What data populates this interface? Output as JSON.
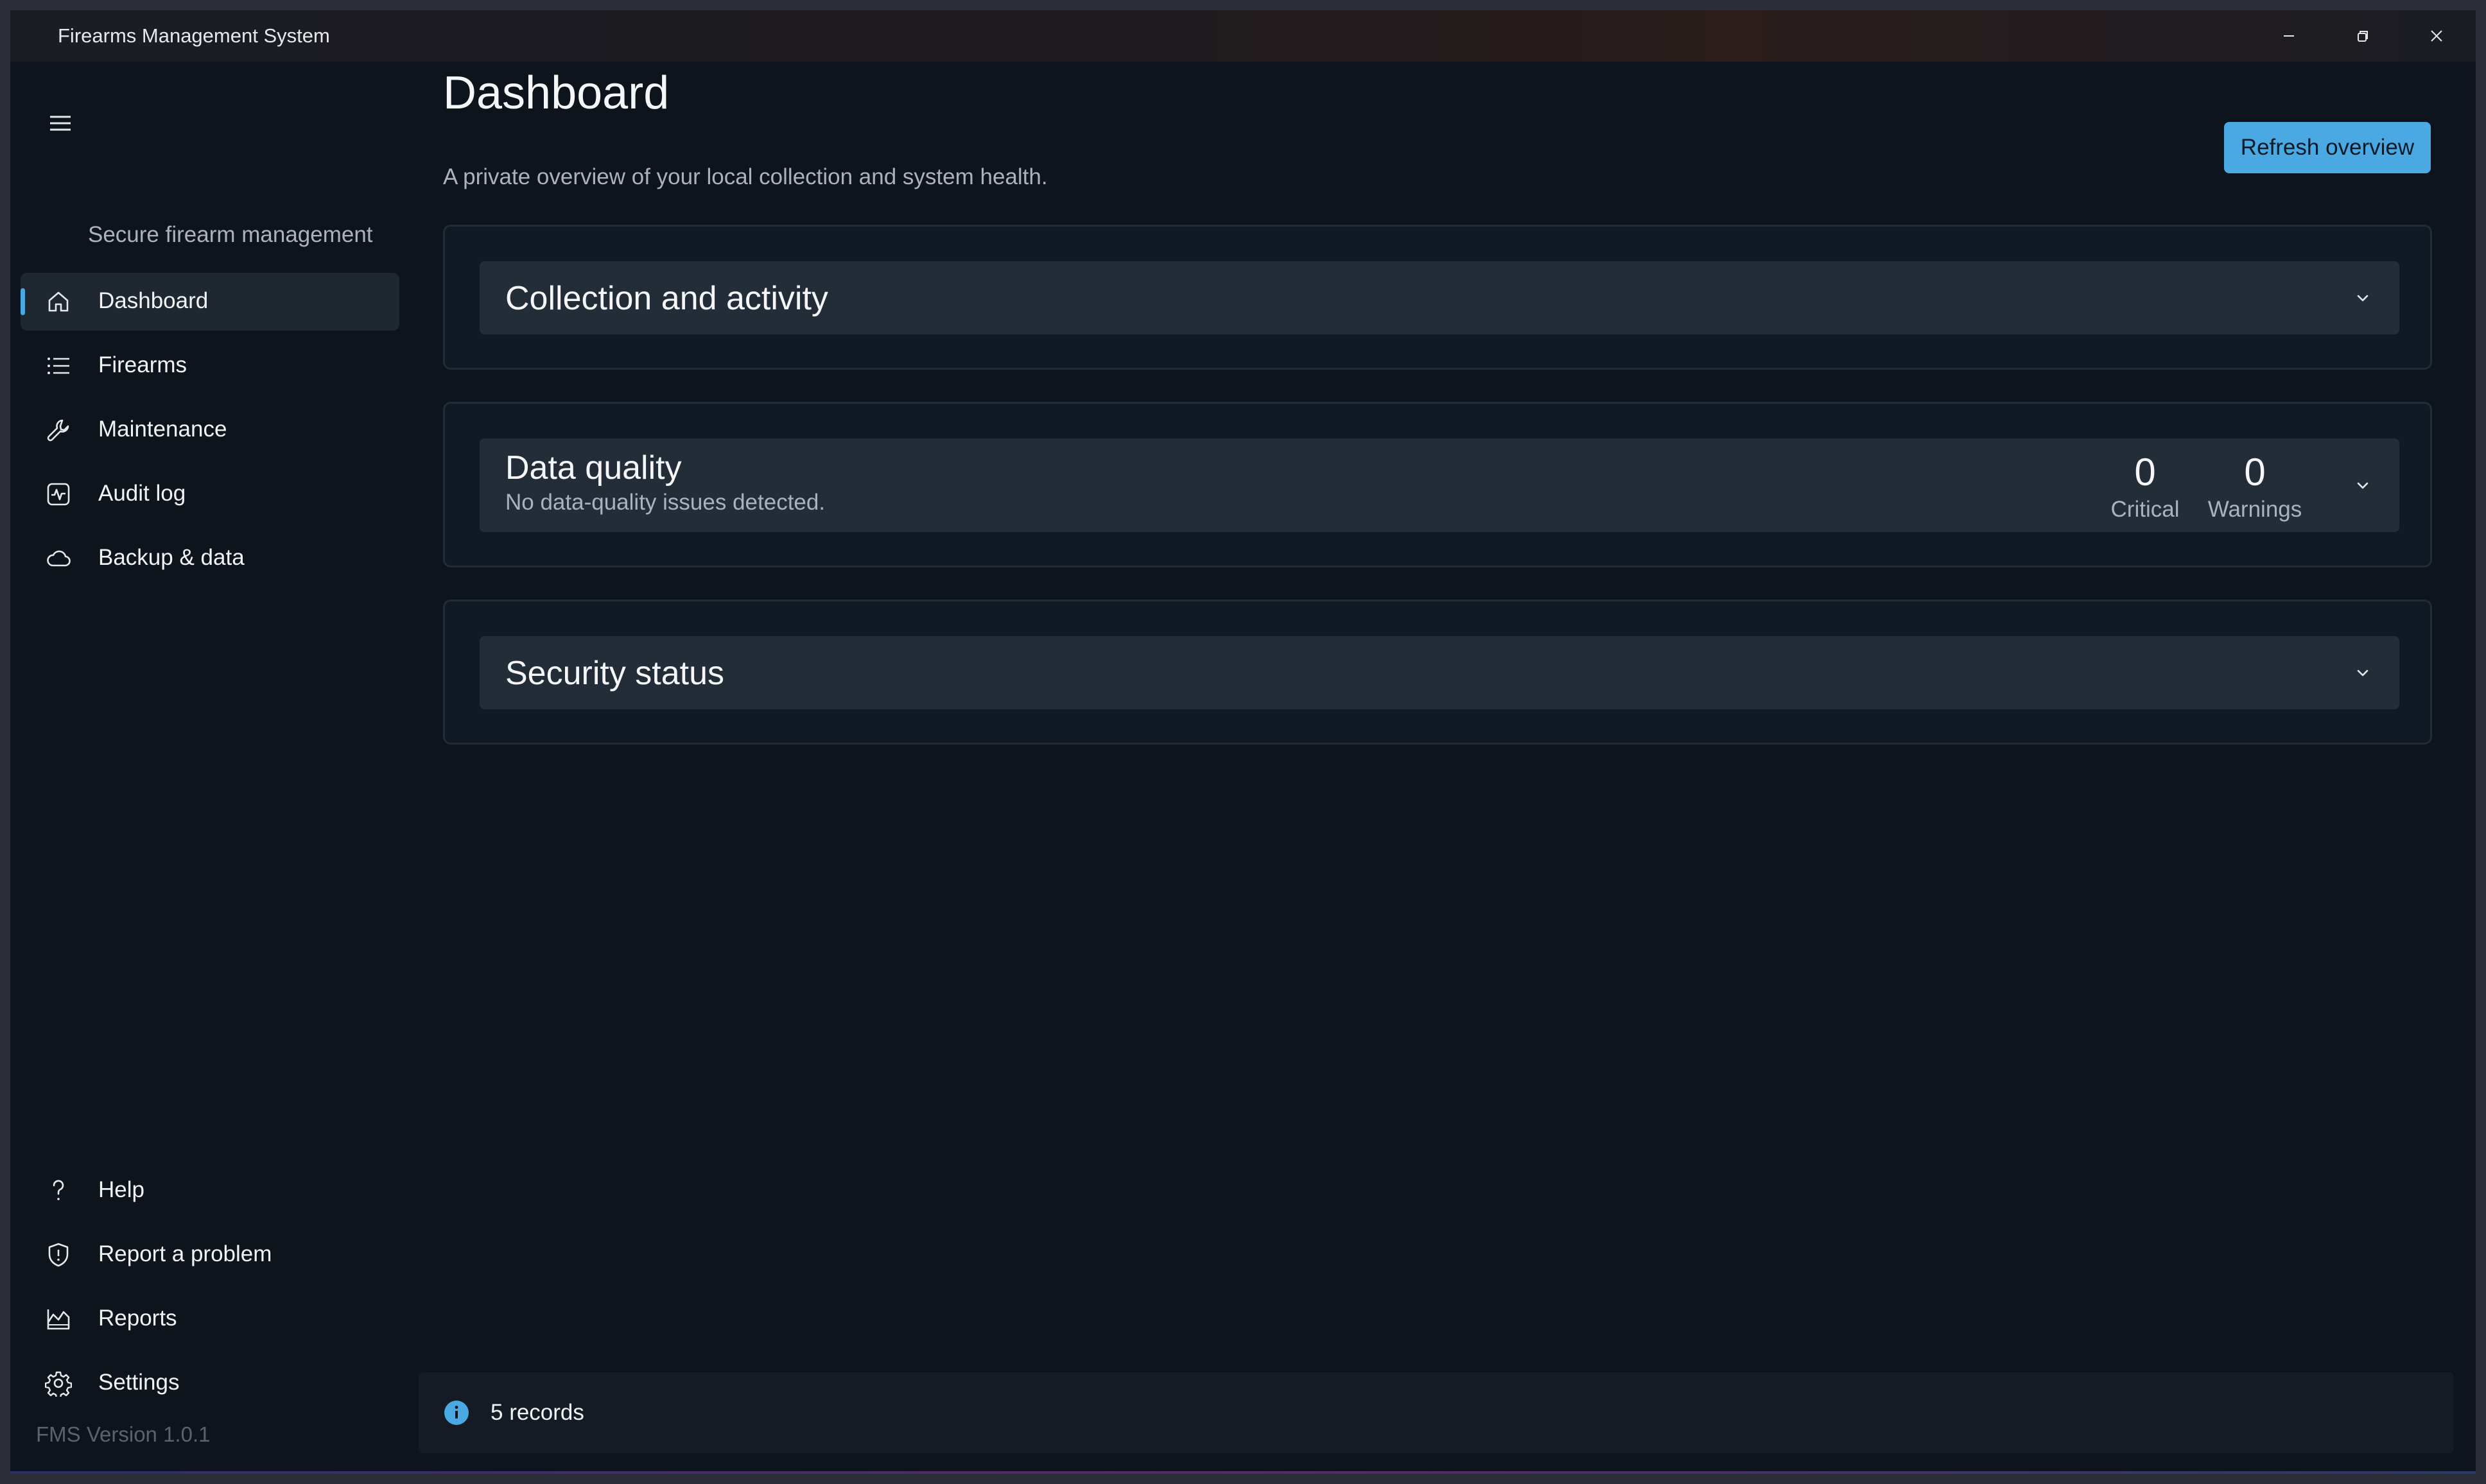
{
  "window": {
    "title": "Firearms Management System"
  },
  "sidebar": {
    "tagline": "Secure firearm management",
    "items": [
      {
        "label": "Dashboard",
        "icon": "home-icon",
        "active": true
      },
      {
        "label": "Firearms",
        "icon": "list-icon"
      },
      {
        "label": "Maintenance",
        "icon": "wrench-icon"
      },
      {
        "label": "Audit log",
        "icon": "activity-icon"
      },
      {
        "label": "Backup & data",
        "icon": "cloud-icon"
      }
    ],
    "footer_items": [
      {
        "label": "Help",
        "icon": "question-icon"
      },
      {
        "label": "Report a problem",
        "icon": "shield-icon"
      },
      {
        "label": "Reports",
        "icon": "chart-icon"
      },
      {
        "label": "Settings",
        "icon": "gear-icon"
      }
    ],
    "version": "FMS Version 1.0.1"
  },
  "main": {
    "title": "Dashboard",
    "subtitle": "A private overview of your local collection and system health.",
    "refresh_label": "Refresh overview",
    "cards": [
      {
        "title": "Collection and activity"
      },
      {
        "title": "Data quality",
        "description": "No data-quality issues detected.",
        "metrics": [
          {
            "value": "0",
            "label": "Critical"
          },
          {
            "value": "0",
            "label": "Warnings"
          }
        ]
      },
      {
        "title": "Security status"
      }
    ]
  },
  "status": {
    "text": "5 records"
  },
  "colors": {
    "accent": "#4aa9e3",
    "background": "#0e141b",
    "card": "#111a24",
    "card_header": "#232d38"
  }
}
